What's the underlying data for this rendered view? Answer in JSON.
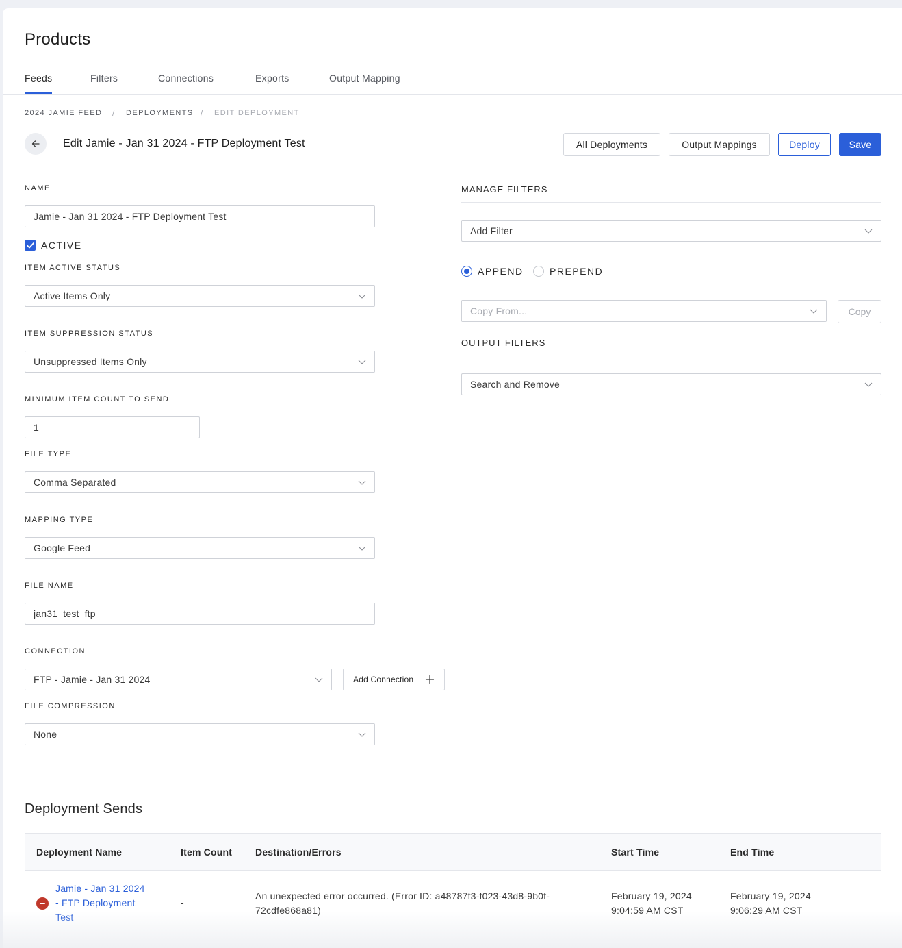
{
  "page": {
    "title": "Products"
  },
  "tabs": [
    {
      "label": "Feeds",
      "active": true
    },
    {
      "label": "Filters"
    },
    {
      "label": "Connections"
    },
    {
      "label": "Exports"
    },
    {
      "label": "Output Mapping"
    }
  ],
  "breadcrumb": [
    "2024 JAMIE FEED",
    "DEPLOYMENTS",
    "EDIT DEPLOYMENT"
  ],
  "header": {
    "title": "Edit Jamie - Jan 31 2024 - FTP Deployment Test",
    "all_deployments": "All Deployments",
    "output_mappings": "Output Mappings",
    "deploy": "Deploy",
    "save": "Save"
  },
  "form": {
    "name_label": "NAME",
    "name_value": "Jamie - Jan 31 2024 - FTP Deployment Test",
    "active_label": "ACTIVE",
    "active_checked": true,
    "item_active_status_label": "ITEM ACTIVE STATUS",
    "item_active_status_value": "Active Items Only",
    "item_suppression_label": "ITEM SUPPRESSION STATUS",
    "item_suppression_value": "Unsuppressed Items Only",
    "min_count_label": "MINIMUM ITEM COUNT TO SEND",
    "min_count_value": "1",
    "file_type_label": "FILE TYPE",
    "file_type_value": "Comma Separated",
    "mapping_type_label": "MAPPING TYPE",
    "mapping_type_value": "Google Feed",
    "file_name_label": "FILE NAME",
    "file_name_value": "jan31_test_ftp",
    "connection_label": "CONNECTION",
    "connection_value": "FTP - Jamie - Jan 31 2024",
    "add_connection": "Add Connection",
    "file_compression_label": "FILE COMPRESSION",
    "file_compression_value": "None"
  },
  "filters": {
    "manage_title": "MANAGE FILTERS",
    "add_filter_placeholder": "Add Filter",
    "append_label": "APPEND",
    "prepend_label": "PREPEND",
    "selected_mode": "append",
    "copy_from_placeholder": "Copy From...",
    "copy_button": "Copy",
    "output_title": "OUTPUT FILTERS",
    "output_value": "Search and Remove"
  },
  "sends": {
    "title": "Deployment Sends",
    "columns": [
      "Deployment Name",
      "Item Count",
      "Destination/Errors",
      "Start Time",
      "End Time"
    ],
    "rows": [
      {
        "status": "error",
        "name_lines": [
          "Jamie - Jan 31 2024",
          "- FTP Deployment",
          "Test"
        ],
        "item_count": "-",
        "destination_lines": [
          "An unexpected error occurred. (Error ID: a48787f3-f023-43d8-9b0f-",
          "72cdfe868a81)"
        ],
        "start_lines": [
          "February 19, 2024",
          "9:04:59 AM CST"
        ],
        "end_lines": [
          "February 19, 2024",
          "9:06:29 AM CST"
        ]
      }
    ]
  }
}
